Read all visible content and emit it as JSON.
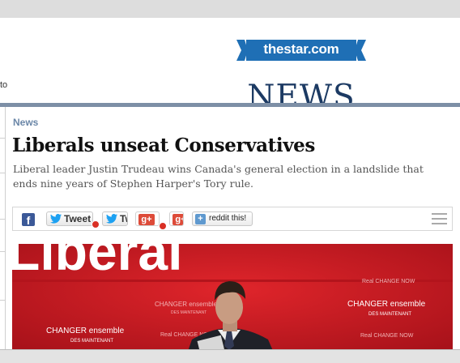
{
  "header": {
    "left_text": "to",
    "logo_text": "thestar.com",
    "section_word": "NEWS"
  },
  "article": {
    "section_label": "News",
    "headline": "Liberals unseat Conservatives",
    "dek": "Liberal leader Justin Trudeau wins Canada's general election in a landslide that ends nine years of Stephen Harper's Tory rule."
  },
  "share": {
    "facebook_icon": "f",
    "tweet_label": "Tweet",
    "tweet2_label": "Tw",
    "gplus_label": "g+",
    "reddit_label": "reddit this!"
  },
  "photo": {
    "backdrop_word": "Liberal",
    "sign_1_line1": "CHANGER ensemble",
    "sign_1_line2": "DES MAINTENANT",
    "sign_2_line1": "CHANGER ensemble",
    "sign_2_line2": "DES MAINTENANT",
    "sign_3_line1": "CHANGER ensemble",
    "sign_3_line2": "DES MAINTENANT",
    "real_change_1": "Real CHANGE NOW",
    "real_change_2": "Real CHANGE NOW",
    "real_change_3": "Real CHANGE NOW"
  },
  "colors": {
    "logo_blue": "#1f6fb5",
    "section_blue": "#1c3a63",
    "label_blue": "#6b87a8",
    "liberal_red": "#c9181f"
  }
}
